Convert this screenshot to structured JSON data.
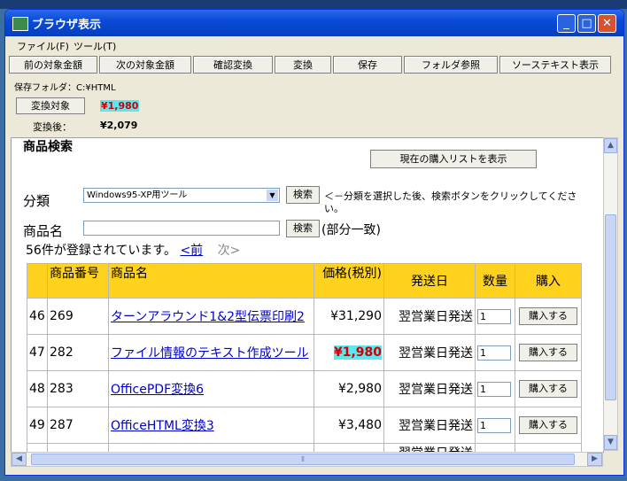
{
  "window": {
    "title": "ブラウザ表示"
  },
  "menu": [
    "ファイル(F)",
    "ツール(T)"
  ],
  "toolbar": [
    "前の対象金額",
    "次の対象金額",
    "確認変換",
    "変換",
    "保存",
    "フォルダ参照",
    "ソーステキスト表示"
  ],
  "folder": {
    "label": "保存フォルダ：C:¥HTML"
  },
  "target": {
    "button_label": "変換対象",
    "value": "¥1,980"
  },
  "after": {
    "label": "変換後：",
    "value": "¥2,079"
  },
  "page": {
    "heading": "商品検索",
    "show_list_button": "現在の購入リストを表示",
    "category_label": "分類",
    "category_selected": "Windows95-XP用ツール",
    "search_button": "検索",
    "category_hint": "＜－分類を選択した後、検索ボタンをクリックしてください。",
    "product_label": "商品名",
    "product_search_button": "検索",
    "partial_match": "(部分一致)",
    "count_text": "56件が登録されています。",
    "prev_link": "<前",
    "next_text": "次>"
  },
  "table": {
    "headers": [
      "",
      "商品番号",
      "商品名",
      "価格(税別)",
      "発送日",
      "数量",
      "購入"
    ],
    "rows": [
      {
        "idx": "46",
        "code": "269",
        "name": "ターンアラウンド1&2型伝票印刷2",
        "price": "¥31,290",
        "ship": "翌営業日発送",
        "qty": "1",
        "buy": "購入する"
      },
      {
        "idx": "47",
        "code": "282",
        "name": "ファイル情報のテキスト作成ツール",
        "price": "¥1,980",
        "ship": "翌営業日発送",
        "qty": "1",
        "buy": "購入する"
      },
      {
        "idx": "48",
        "code": "283",
        "name": "OfficePDF変換6",
        "price": "¥2,980",
        "ship": "翌営業日発送",
        "qty": "1",
        "buy": "購入する"
      },
      {
        "idx": "49",
        "code": "287",
        "name": "OfficeHTML変換3",
        "price": "¥3,480",
        "ship": "翌営業日発送",
        "qty": "1",
        "buy": "購入する"
      },
      {
        "idx": "",
        "code": "",
        "name": "",
        "price": "",
        "ship": "翌営業日発送",
        "qty": "",
        "buy": ""
      }
    ]
  },
  "colors": {
    "header_yellow": "#ffd21e",
    "highlight": "#5ee6f0",
    "price_red": "#cc0000",
    "titlebar": "#0a4bd6"
  },
  "icons": {
    "minimize": "minimize-icon",
    "maximize": "maximize-icon",
    "close": "close-icon",
    "scroll_up": "arrow-up-icon",
    "scroll_down": "arrow-down-icon",
    "scroll_left": "arrow-left-icon",
    "scroll_right": "arrow-right-icon"
  }
}
